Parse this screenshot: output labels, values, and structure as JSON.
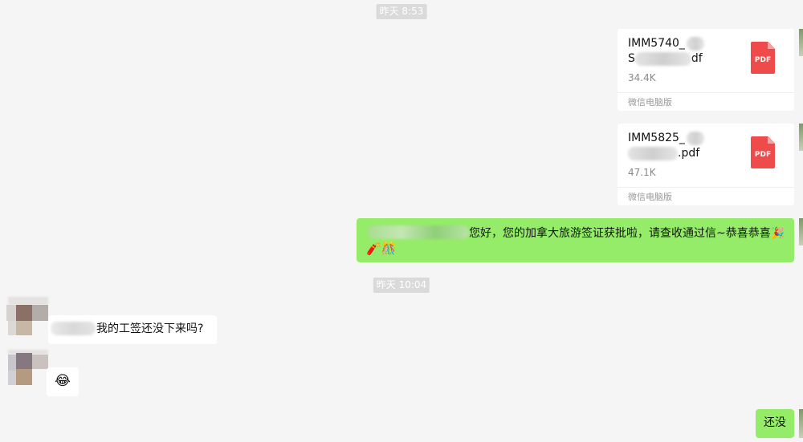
{
  "timestamps": [
    "昨天 8:53",
    "昨天 10:04"
  ],
  "files": [
    {
      "name_line1": "IMM5740_",
      "name_line2_prefix": "S",
      "name_line2_suffix": "df",
      "size": "34.4K",
      "source": "微信电脑版",
      "icon_label": "PDF"
    },
    {
      "name_line1": "IMM5825_",
      "name_line2_prefix": "",
      "name_line2_suffix": ".pdf",
      "size": "47.1K",
      "source": "微信电脑版",
      "icon_label": "PDF"
    }
  ],
  "messages": {
    "approval_text": "您好，您的加拿大旅游签证获批啦，请查收通过信~恭喜恭喜",
    "approval_emojis": [
      "🎉",
      "🧨",
      "🎊"
    ],
    "question_text": "我的工签还没下来吗?",
    "reaction_emoji": "😂",
    "reply_text": "还没"
  },
  "colors": {
    "background": "#f5f5f5",
    "self_bubble": "#95ec69",
    "other_bubble": "#ffffff",
    "pdf_icon": "#f04b4b",
    "timestamp_bg": "#dadada"
  }
}
